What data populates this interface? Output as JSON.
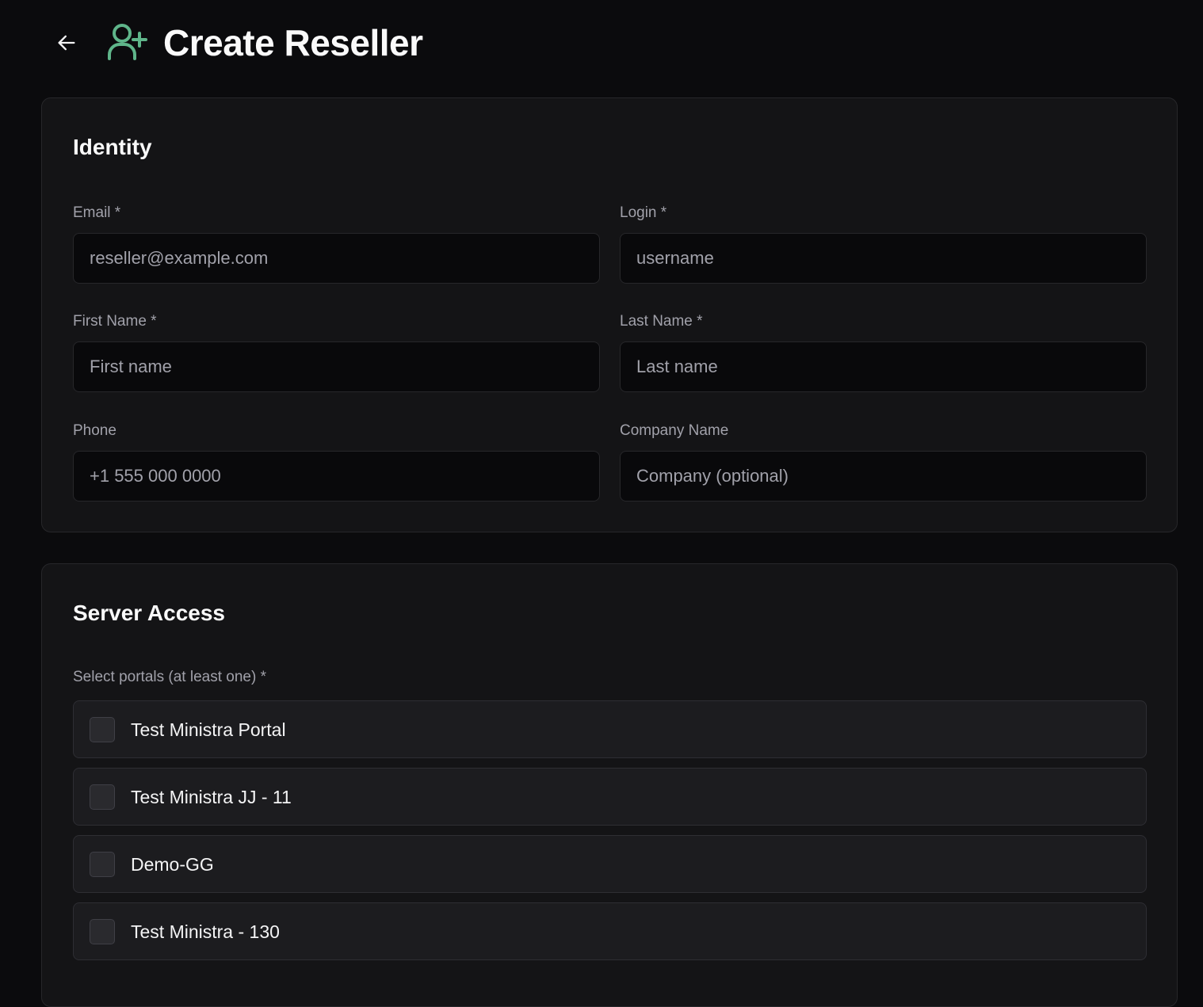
{
  "header": {
    "back_icon": "arrow-left-icon",
    "title_icon": "user-plus-icon",
    "title": "Create Reseller",
    "accent_color": "#5fb58a"
  },
  "identity": {
    "title": "Identity",
    "fields": {
      "email": {
        "label": "Email *",
        "placeholder": "reseller@example.com",
        "value": ""
      },
      "login": {
        "label": "Login *",
        "placeholder": "username",
        "value": ""
      },
      "first_name": {
        "label": "First Name *",
        "placeholder": "First name",
        "value": ""
      },
      "last_name": {
        "label": "Last Name *",
        "placeholder": "Last name",
        "value": ""
      },
      "phone": {
        "label": "Phone",
        "placeholder": "+1 555 000 0000",
        "value": ""
      },
      "company": {
        "label": "Company Name",
        "placeholder": "Company (optional)",
        "value": ""
      }
    }
  },
  "server_access": {
    "title": "Server Access",
    "portals_label": "Select portals (at least one) *",
    "portals": [
      {
        "label": "Test Ministra Portal",
        "checked": false
      },
      {
        "label": "Test Ministra JJ - 11",
        "checked": false
      },
      {
        "label": "Demo-GG",
        "checked": false
      },
      {
        "label": "Test Ministra - 130",
        "checked": false
      }
    ]
  }
}
